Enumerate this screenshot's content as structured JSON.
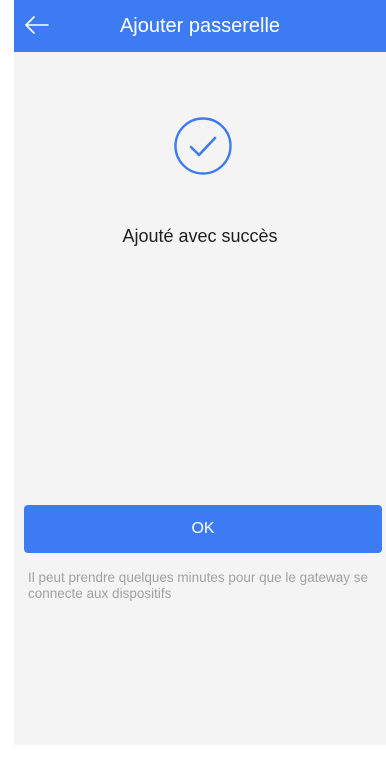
{
  "header": {
    "title": "Ajouter passerelle",
    "back_icon": "arrow-left-icon"
  },
  "main": {
    "status_icon": "check-circle-icon",
    "success_message": "Ajouté avec succès",
    "ok_label": "OK",
    "note": "Il peut prendre quelques minutes pour que le gateway se connecte aux dispositifs"
  },
  "colors": {
    "accent": "#3d7bf3",
    "background": "#f4f4f4",
    "note_text": "#a2a2a2"
  }
}
